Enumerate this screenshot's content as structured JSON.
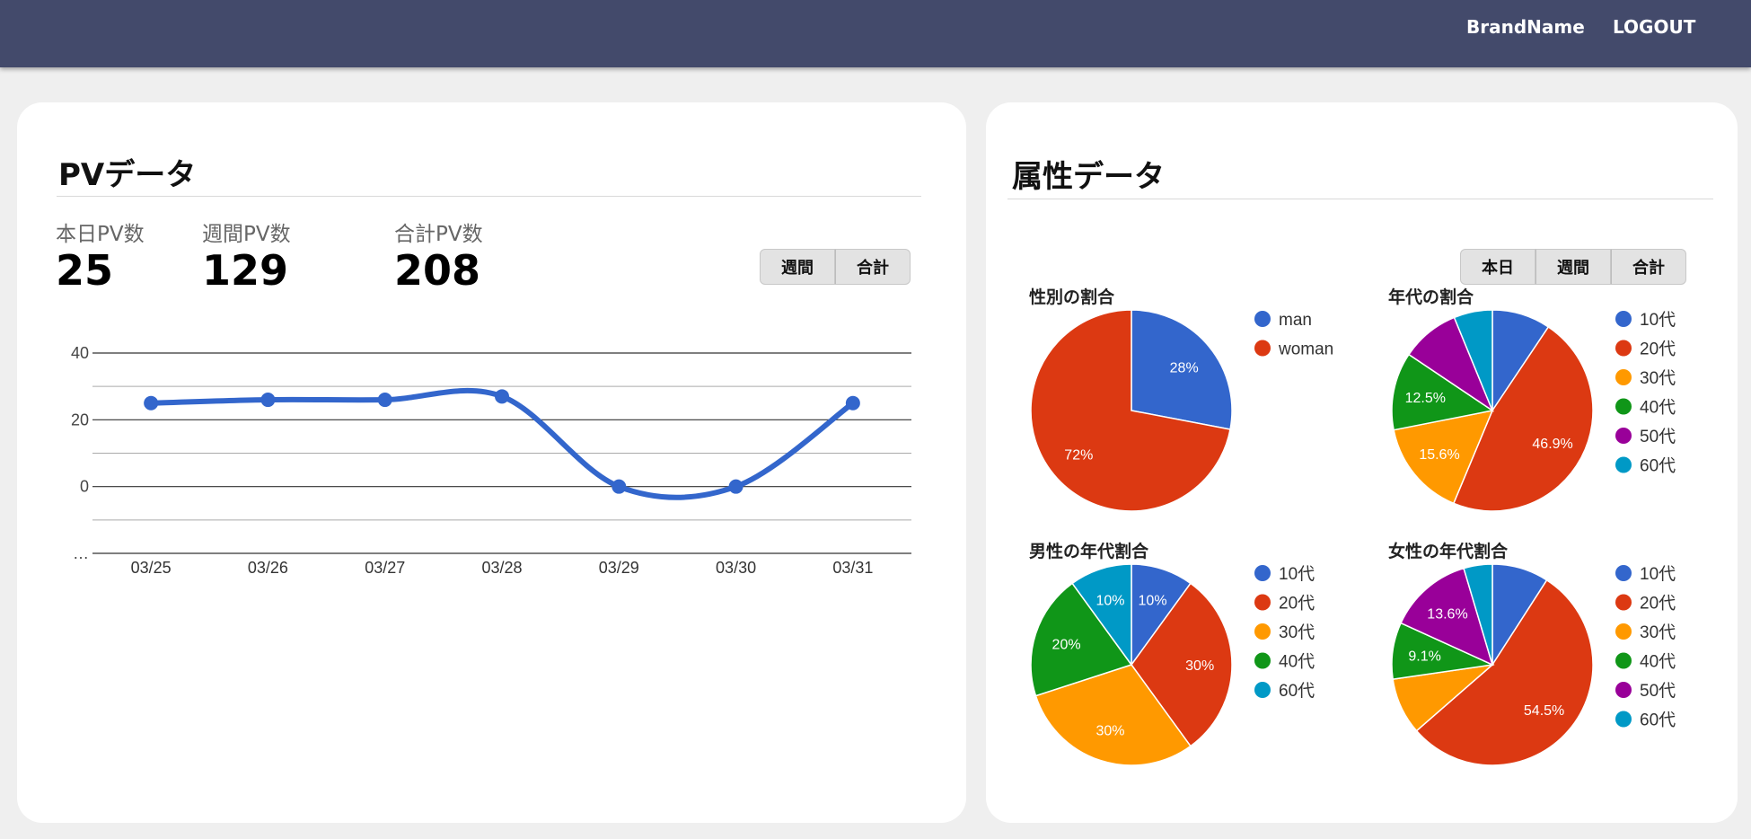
{
  "header": {
    "brand": "BrandName",
    "logout": "LOGOUT"
  },
  "pv": {
    "title": "PVデータ",
    "stats": [
      {
        "label": "本日PV数",
        "value": "25"
      },
      {
        "label": "週間PV数",
        "value": "129"
      },
      {
        "label": "合計PV数",
        "value": "208"
      }
    ],
    "buttons": [
      "週間",
      "合計"
    ]
  },
  "attr": {
    "title": "属性データ",
    "buttons": [
      "本日",
      "週間",
      "合計"
    ]
  },
  "colors": {
    "blue": "#3366cc",
    "red": "#dc3912",
    "orange": "#ff9900",
    "green": "#109618",
    "purple": "#990099",
    "teal": "#0099c6"
  },
  "chart_data": [
    {
      "type": "line",
      "x": [
        "03/25",
        "03/26",
        "03/27",
        "03/28",
        "03/29",
        "03/30",
        "03/31"
      ],
      "series": [
        {
          "values": [
            25,
            26,
            26,
            27,
            0,
            0,
            25
          ],
          "color": "#3366cc"
        }
      ],
      "y_ticks": [
        "40",
        "20",
        "0",
        "…"
      ],
      "ylim": [
        -20,
        40
      ],
      "grid": true,
      "curve": "smooth"
    },
    {
      "type": "pie",
      "title": "性別の割合",
      "labels": [
        "man",
        "woman"
      ],
      "values": [
        28,
        72
      ],
      "slice_labels": [
        "28%",
        "72%"
      ],
      "colors": [
        "#3366cc",
        "#dc3912"
      ],
      "legend_position": "right"
    },
    {
      "type": "pie",
      "title": "年代の割合",
      "labels": [
        "10代",
        "20代",
        "30代",
        "40代",
        "50代",
        "60代"
      ],
      "values": [
        9.4,
        46.9,
        15.6,
        12.5,
        9.4,
        6.2
      ],
      "slice_labels": [
        "",
        "46.9%",
        "15.6%",
        "12.5%",
        "",
        ""
      ],
      "colors": [
        "#3366cc",
        "#dc3912",
        "#ff9900",
        "#109618",
        "#990099",
        "#0099c6"
      ],
      "legend_position": "right"
    },
    {
      "type": "pie",
      "title": "男性の年代割合",
      "labels": [
        "10代",
        "20代",
        "30代",
        "40代",
        "60代"
      ],
      "values": [
        10,
        30,
        30,
        20,
        10
      ],
      "slice_labels": [
        "10%",
        "30%",
        "30%",
        "20%",
        "10%"
      ],
      "colors": [
        "#3366cc",
        "#dc3912",
        "#ff9900",
        "#109618",
        "#0099c6"
      ],
      "legend_position": "right"
    },
    {
      "type": "pie",
      "title": "女性の年代割合",
      "labels": [
        "10代",
        "20代",
        "30代",
        "40代",
        "50代",
        "60代"
      ],
      "values": [
        9.1,
        54.5,
        9.1,
        9.1,
        13.6,
        4.6
      ],
      "slice_labels": [
        "",
        "54.5%",
        "",
        "9.1%",
        "13.6%",
        ""
      ],
      "colors": [
        "#3366cc",
        "#dc3912",
        "#ff9900",
        "#109618",
        "#990099",
        "#0099c6"
      ],
      "legend_position": "right"
    }
  ]
}
